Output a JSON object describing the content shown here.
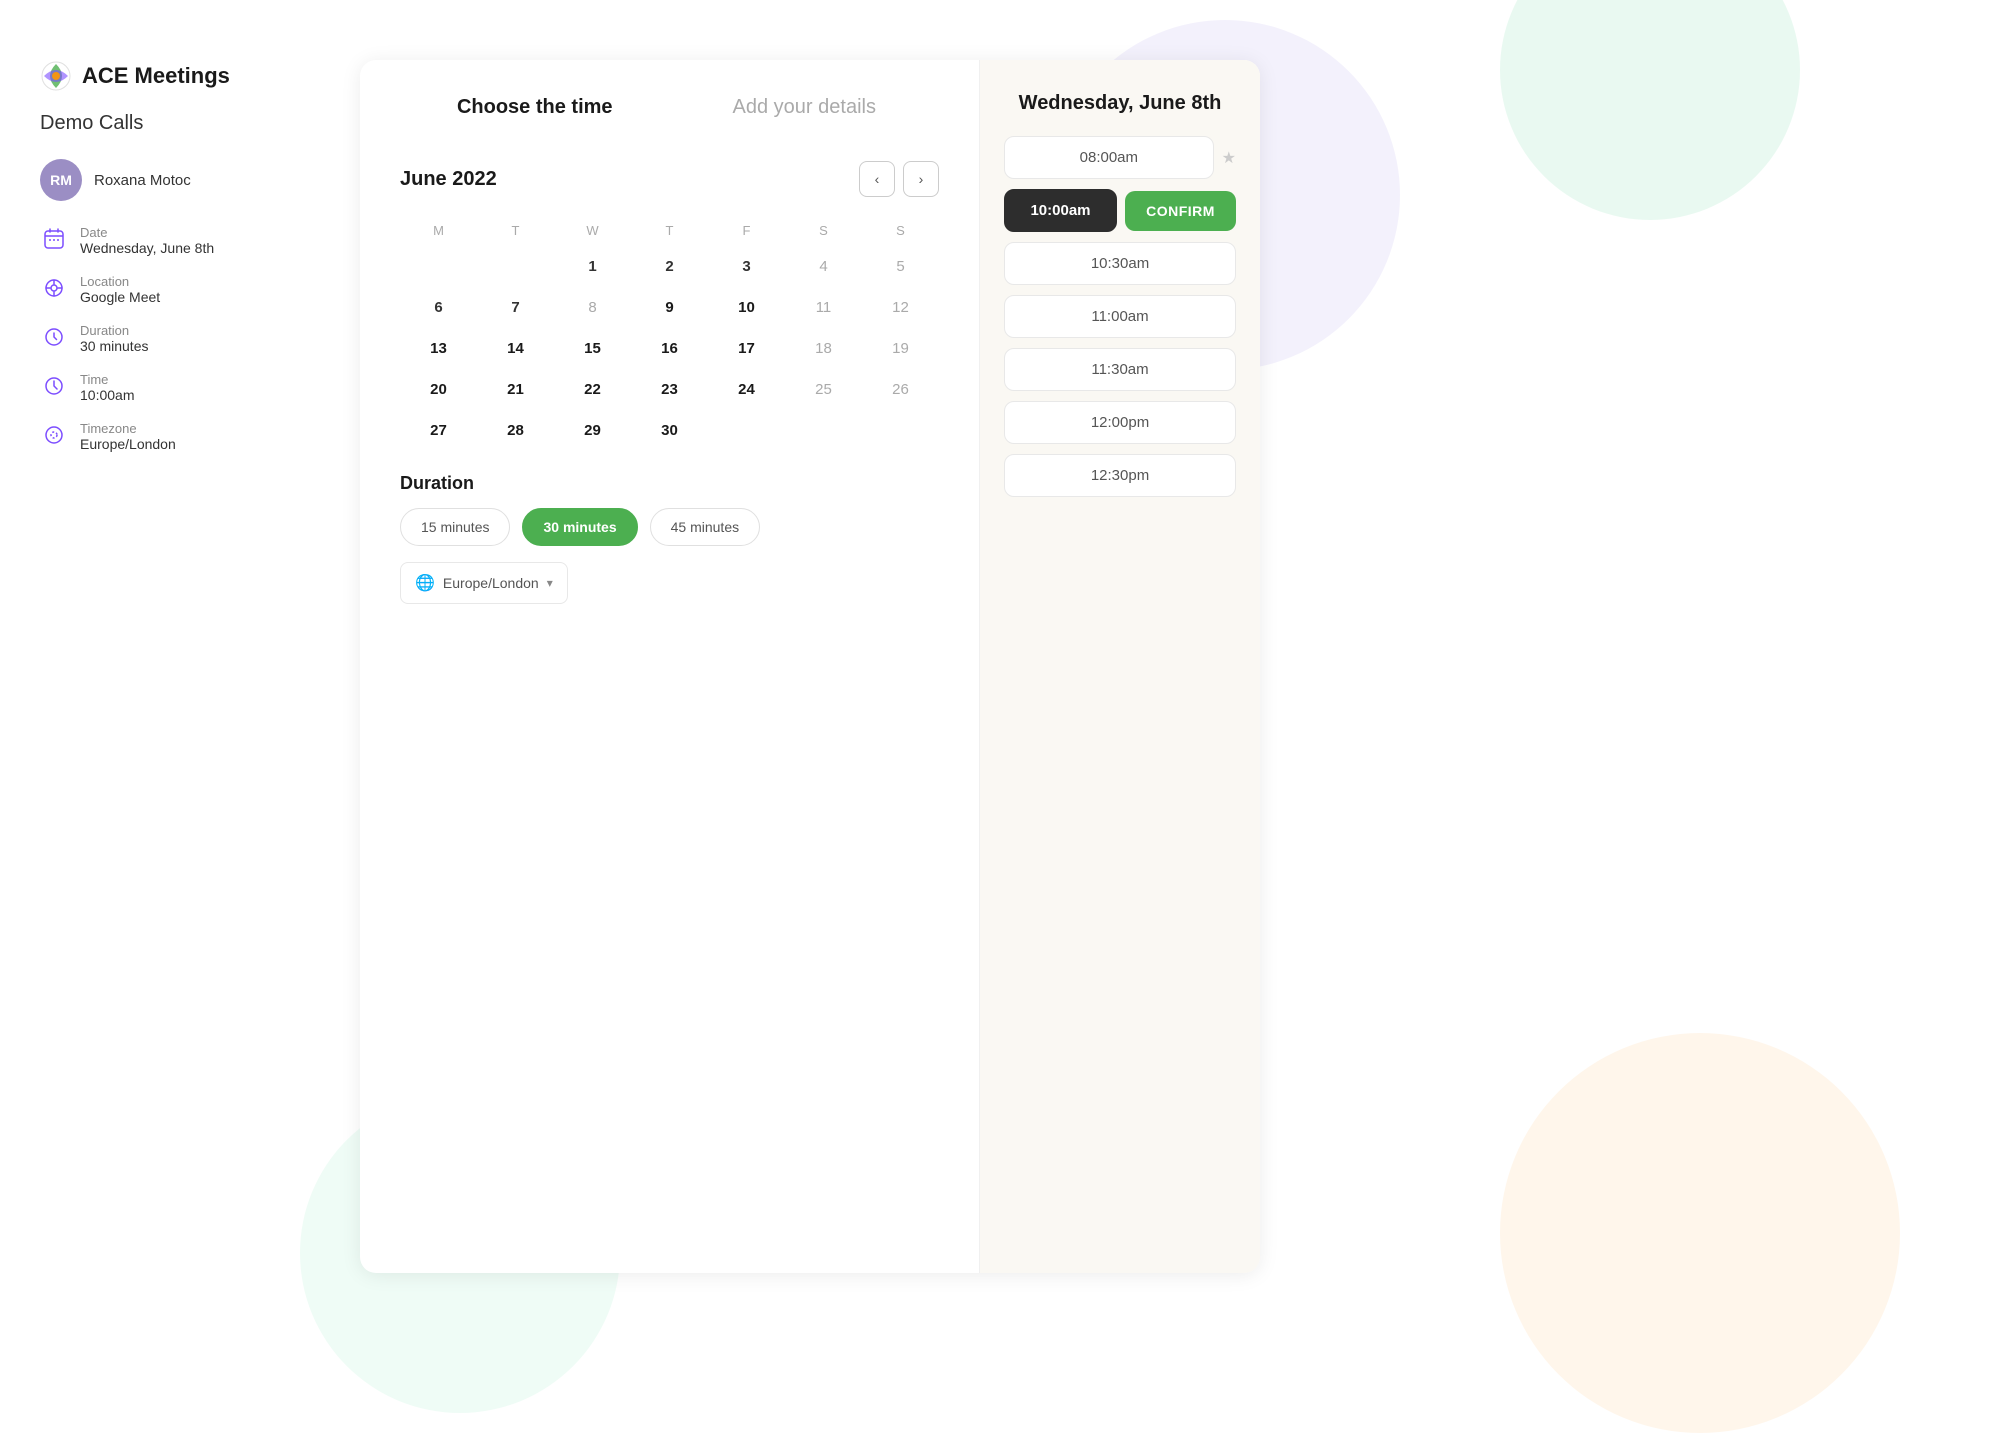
{
  "app": {
    "title": "ACE Meetings"
  },
  "sidebar": {
    "page_title": "Demo Calls",
    "host": {
      "initials": "RM",
      "name": "Roxana Motoc"
    },
    "info_items": [
      {
        "id": "date",
        "label": "Date",
        "value": "Wednesday, June 8th"
      },
      {
        "id": "location",
        "label": "Location",
        "value": "Google Meet"
      },
      {
        "id": "duration",
        "label": "Duration",
        "value": "30 minutes"
      },
      {
        "id": "time",
        "label": "Time",
        "value": "10:00am"
      },
      {
        "id": "timezone",
        "label": "Timezone",
        "value": "Europe/London"
      }
    ]
  },
  "calendar": {
    "step1_label": "Choose the time",
    "step2_label": "Add your details",
    "month_year": "June 2022",
    "nav_prev": "‹",
    "nav_next": "›",
    "day_headers": [
      "M",
      "T",
      "W",
      "T",
      "F",
      "S",
      "S"
    ],
    "weeks": [
      [
        null,
        null,
        "1",
        "2",
        "3",
        "4",
        "5"
      ],
      [
        "6",
        "7",
        "8",
        "9",
        "10",
        "11",
        "12"
      ],
      [
        "13",
        "14",
        "15",
        "16",
        "17",
        "18",
        "19"
      ],
      [
        "20",
        "21",
        "22",
        "23",
        "24",
        "25",
        "26"
      ],
      [
        "27",
        "28",
        "29",
        "30",
        null,
        null,
        null
      ]
    ],
    "selected_day": "8",
    "active_days": [
      "1",
      "2",
      "3",
      "4",
      "5",
      "6",
      "7",
      "8",
      "9",
      "10",
      "11",
      "12",
      "13",
      "14",
      "15",
      "16",
      "17",
      "18",
      "19",
      "20",
      "21",
      "22",
      "23",
      "24",
      "27",
      "28",
      "29",
      "30"
    ],
    "bold_days": [
      "9",
      "10",
      "13",
      "14",
      "15",
      "16",
      "17",
      "20",
      "21",
      "22",
      "23",
      "24",
      "27",
      "28",
      "29",
      "30"
    ]
  },
  "duration": {
    "title": "Duration",
    "options": [
      {
        "id": "15min",
        "label": "15 minutes",
        "selected": false
      },
      {
        "id": "30min",
        "label": "30 minutes",
        "selected": true
      },
      {
        "id": "45min",
        "label": "45 minutes",
        "selected": false
      }
    ],
    "timezone": {
      "value": "Europe/London",
      "icon": "🌐"
    }
  },
  "time_picker": {
    "selected_date": "Wednesday, June 8th",
    "slots": [
      {
        "id": "800",
        "time": "08:00am",
        "starred": true,
        "active": false
      },
      {
        "id": "1000",
        "time": "10:00am",
        "starred": false,
        "active": true
      },
      {
        "id": "1030",
        "time": "10:30am",
        "starred": false,
        "active": false
      },
      {
        "id": "1100",
        "time": "11:00am",
        "starred": false,
        "active": false
      },
      {
        "id": "1130",
        "time": "11:30am",
        "starred": false,
        "active": false
      },
      {
        "id": "1200",
        "time": "12:00pm",
        "starred": false,
        "active": false
      },
      {
        "id": "1230",
        "time": "12:30pm",
        "starred": false,
        "active": false
      }
    ],
    "confirm_label": "CONFIRM"
  }
}
